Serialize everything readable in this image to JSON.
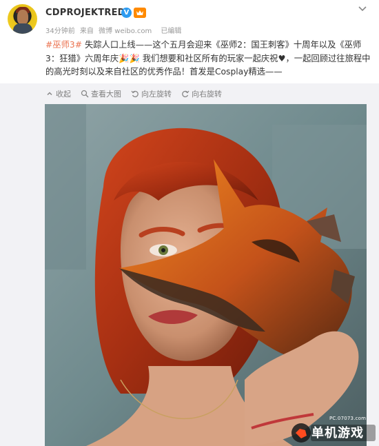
{
  "post": {
    "username": "CDPROJEKTRED",
    "verified_glyph": "V",
    "time": "34分钟前",
    "source_prefix": "来自",
    "source": "微博 weibo.com",
    "status": "已编辑",
    "hashtag": "#巫师3#",
    "text": " 失踪人口上线——这个五月会迎来《巫师2：国王刺客》十周年以及《巫师3：狂猎》六周年庆🎉🎉 我们想要和社区所有的玩家一起庆祝♥，一起回顾过往旅程中的高光时刻以及来自社区的优秀作品！首发是Cosplay精选——"
  },
  "toolbar": {
    "collapse_label": "收起",
    "view_large_label": "查看大图",
    "rotate_left_label": "向左旋转",
    "rotate_right_label": "向右旋转"
  },
  "watermark": {
    "url": "PC.07073.com",
    "brand": "单机游戏"
  },
  "colors": {
    "hashtag": "#eb7350",
    "verified": "#2d9bf0",
    "meta": "#999999"
  },
  "icons": [
    "avatar",
    "verified-badge-icon",
    "vip-badge-icon",
    "chevron-down-icon",
    "collapse-icon",
    "zoom-icon",
    "rotate-left-icon",
    "rotate-right-icon"
  ]
}
